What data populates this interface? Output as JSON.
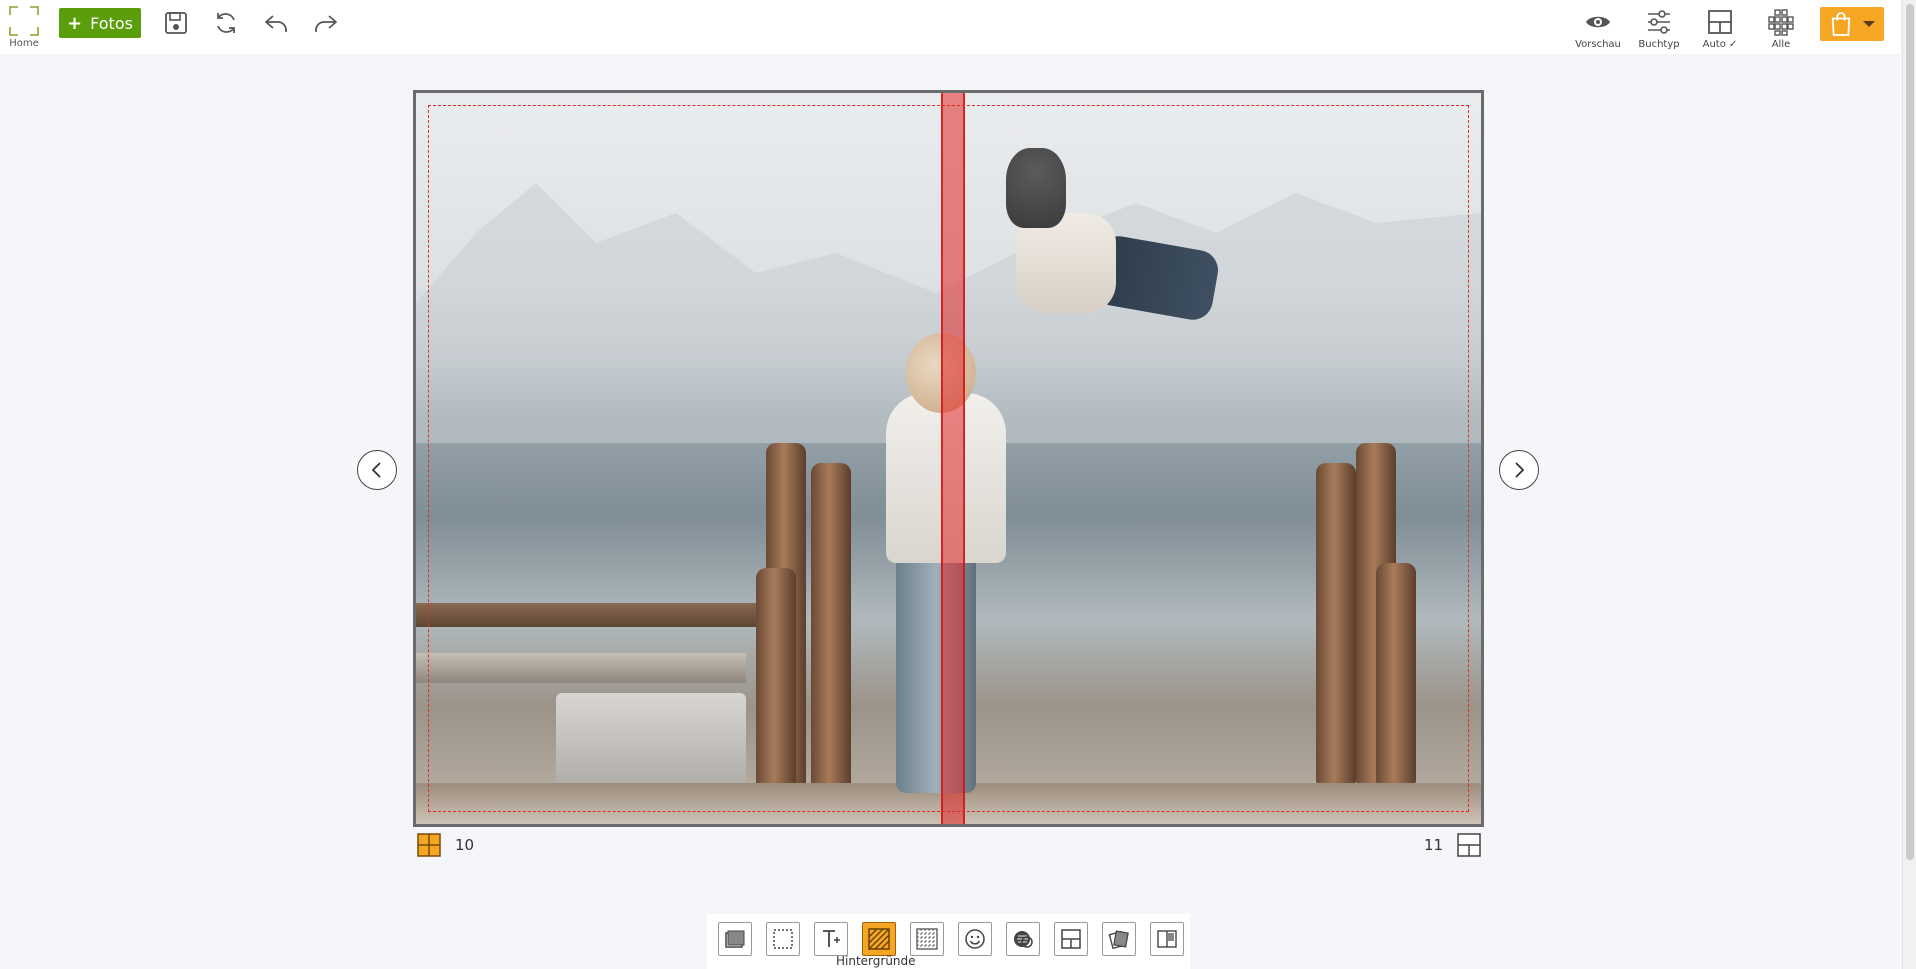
{
  "header": {
    "home_label": "Home",
    "add_photos_label": "Fotos",
    "preview_label": "Vorschau",
    "booktype_label": "Buchtyp",
    "auto_label": "Auto ✓",
    "all_label": "Alle"
  },
  "pages": {
    "left_number": "10",
    "right_number": "11"
  },
  "bottom_toolbar": {
    "active_label": "Hintergründe"
  },
  "colors": {
    "accent_green": "#5a9e0b",
    "accent_orange": "#f5a623",
    "bleed_red": "#e12b2b"
  },
  "icons": {
    "home": "home-frame-icon",
    "save": "save-icon",
    "refresh": "refresh-icon",
    "undo": "undo-icon",
    "redo": "redo-icon",
    "preview": "eye-icon",
    "booktype": "sliders-icon",
    "auto": "layout-grid-icon",
    "all": "all-pages-icon",
    "cart": "shopping-bag-icon"
  }
}
